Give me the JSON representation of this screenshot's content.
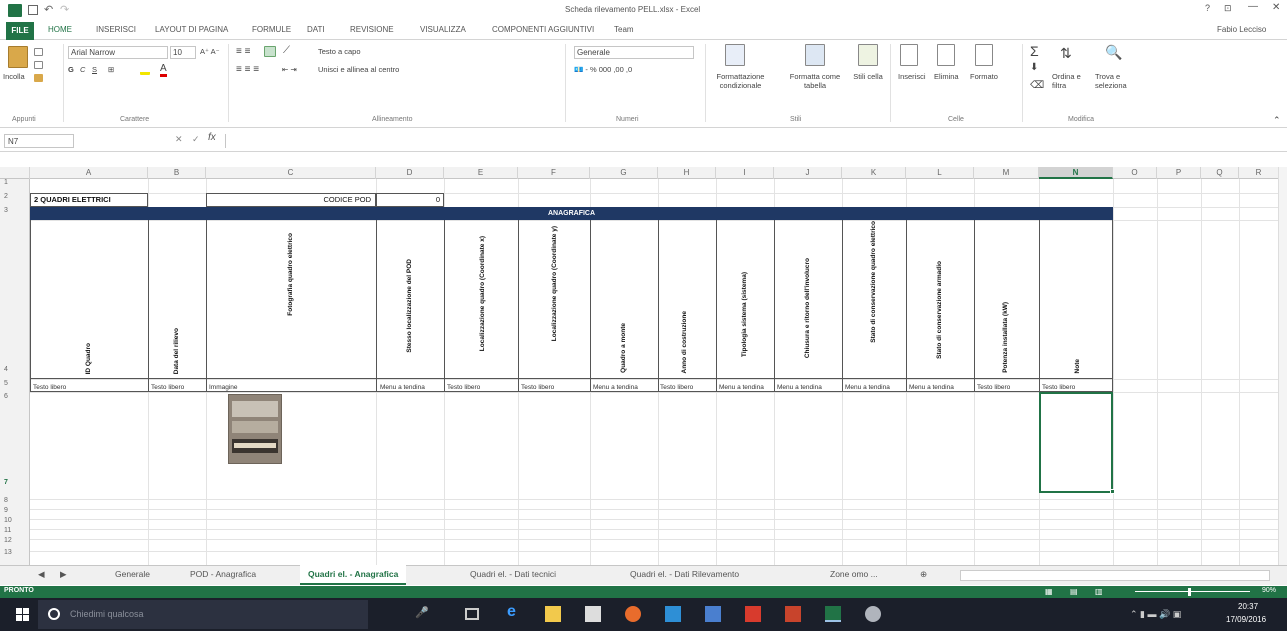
{
  "window": {
    "title": "Scheda rilevamento PELL.xlsx - Excel",
    "user": "Fabio Lecciso",
    "controls": [
      "?",
      "⊡",
      "—",
      "▢",
      "✕"
    ]
  },
  "ribbon_tabs": [
    "FILE",
    "HOME",
    "INSERISCI",
    "LAYOUT DI PAGINA",
    "FORMULE",
    "DATI",
    "REVISIONE",
    "VISUALIZZA",
    "COMPONENTI AGGIUNTIVI",
    "Team"
  ],
  "ribbon": {
    "paste": "Incolla",
    "font_name": "Arial Narrow",
    "font_size": "10",
    "wrap_text": "Testo a capo",
    "merge_center": "Unisci e allinea al centro",
    "number_format": "Generale",
    "conditional_format": "Formattazione condizionale",
    "format_as_table": "Formatta come tabella",
    "cell_styles": "Stili cella",
    "insert": "Inserisci",
    "delete": "Elimina",
    "format": "Formato",
    "sort_filter": "Ordina e filtra",
    "find_select": "Trova e seleziona",
    "groups": [
      "Appunti",
      "Carattere",
      "Allineamento",
      "Numeri",
      "Stili",
      "Celle",
      "Modifica"
    ]
  },
  "formula_bar": {
    "name_box": "N7",
    "fx": "fx",
    "value": ""
  },
  "columns": [
    "A",
    "B",
    "C",
    "D",
    "E",
    "F",
    "G",
    "H",
    "I",
    "J",
    "K",
    "L",
    "M",
    "N",
    "O",
    "P",
    "Q",
    "R"
  ],
  "selected_column": "N",
  "rows": [
    "1",
    "2",
    "3",
    "4",
    "5",
    "6",
    "7",
    "8",
    "9",
    "10",
    "11",
    "12",
    "13"
  ],
  "sheet": {
    "title_cell": "2 QUADRI ELETTRICI",
    "codice_pod_label": "CODICE POD",
    "codice_pod_value": "0",
    "anagrafica": "ANAGRAFICA",
    "headers": [
      "ID Quadro",
      "Data del rilievo",
      "Fotografia quadro elettrico",
      "Stesso localizzazione del POD",
      "Localizzazione quadro (Coordinate x)",
      "Localizzazione quadro (Coordinate y)",
      "Quadro a monte",
      "Anno di costruzione",
      "Tipologia sistema (sistema)",
      "Chiusura e ritorno dell'involucro",
      "Stato di conservazione quadro elettrico",
      "Stato di conservazione armadio",
      "Potenza installata (kW)",
      "Note"
    ],
    "types": [
      "Testo libero",
      "Testo libero",
      "Immagine",
      "Menu a tendina",
      "Testo libero",
      "Testo libero",
      "Menu a tendina",
      "Testo libero",
      "Menu a tendina",
      "Menu a tendina",
      "Menu a tendina",
      "Menu a tendina",
      "Testo libero",
      "Testo libero"
    ]
  },
  "sheet_tabs": [
    "Generale",
    "POD - Anagrafica",
    "Quadri el. - Anagrafica",
    "Quadri el. - Dati tecnici",
    "Quadri el. - Dati Rilevamento",
    "Zone omo ..."
  ],
  "active_sheet": "Quadri el. - Anagrafica",
  "status": {
    "mode": "PRONTO",
    "zoom": "90%"
  },
  "taskbar": {
    "search_placeholder": "Chiedimi qualcosa",
    "time": "20:37",
    "date": "17/09/2016"
  },
  "colors": {
    "excel_green": "#217346",
    "header_blue": "#1f3864",
    "taskbar": "#1b1f2a"
  }
}
